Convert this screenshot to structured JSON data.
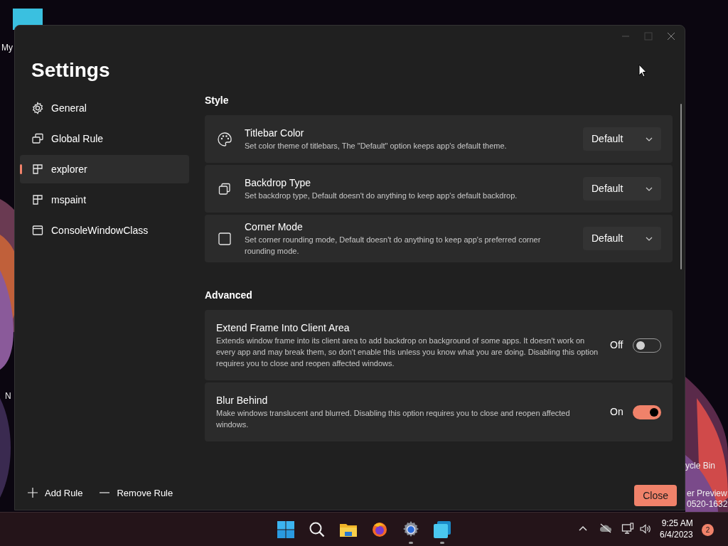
{
  "desktop": {
    "labels": [
      {
        "text": "My"
      },
      {
        "text": "N"
      },
      {
        "text": "ycle Bin"
      },
      {
        "text": "er Preview"
      },
      {
        "text": "0520-1632"
      }
    ]
  },
  "window": {
    "title": "Settings"
  },
  "sidebar": {
    "items": [
      {
        "label": "General",
        "kind": "gear",
        "selected": false
      },
      {
        "label": "Global Rule",
        "kind": "windows",
        "selected": false
      },
      {
        "label": "explorer",
        "kind": "app",
        "selected": true
      },
      {
        "label": "mspaint",
        "kind": "app",
        "selected": false
      },
      {
        "label": "ConsoleWindowClass",
        "kind": "console",
        "selected": false
      }
    ]
  },
  "sections": [
    {
      "heading": "Style",
      "items": [
        {
          "kind": "dropdown",
          "title": "Titlebar Color",
          "description": "Set color theme of titlebars, The \"Default\" option keeps app's default theme.",
          "value": "Default"
        },
        {
          "kind": "dropdown",
          "title": "Backdrop Type",
          "description": "Set backdrop type, Default doesn't do anything to keep app's default backdrop.",
          "value": "Default"
        },
        {
          "kind": "dropdown",
          "title": "Corner Mode",
          "description": "Set corner rounding mode, Default doesn't do anything to keep app's preferred corner rounding mode.",
          "value": "Default"
        }
      ]
    },
    {
      "heading": "Advanced",
      "items": [
        {
          "kind": "toggle",
          "title": "Extend Frame Into Client Area",
          "description": "Extends window frame into its client area to add backdrop on background of some apps. It doesn't work on every app and may break them, so don't enable this unless you know what you are doing. Disabling this option requires you to close and reopen affected windows.",
          "state_label": "Off",
          "on": false
        },
        {
          "kind": "toggle",
          "title": "Blur Behind",
          "description": "Make windows translucent and blurred. Disabling this option requires you to close and reopen affected windows.",
          "state_label": "On",
          "on": true
        }
      ]
    }
  ],
  "footer": {
    "add_rule": "Add Rule",
    "remove_rule": "Remove Rule",
    "close": "Close"
  },
  "taskbar": {
    "apps": [
      {
        "kind": "start",
        "running": false
      },
      {
        "kind": "search",
        "running": false
      },
      {
        "kind": "folder",
        "running": false
      },
      {
        "kind": "browser",
        "running": false
      },
      {
        "kind": "settings",
        "running": true
      },
      {
        "kind": "squares",
        "running": true
      }
    ],
    "time": "9:25 AM",
    "date": "6/4/2023",
    "notifications": "2"
  }
}
